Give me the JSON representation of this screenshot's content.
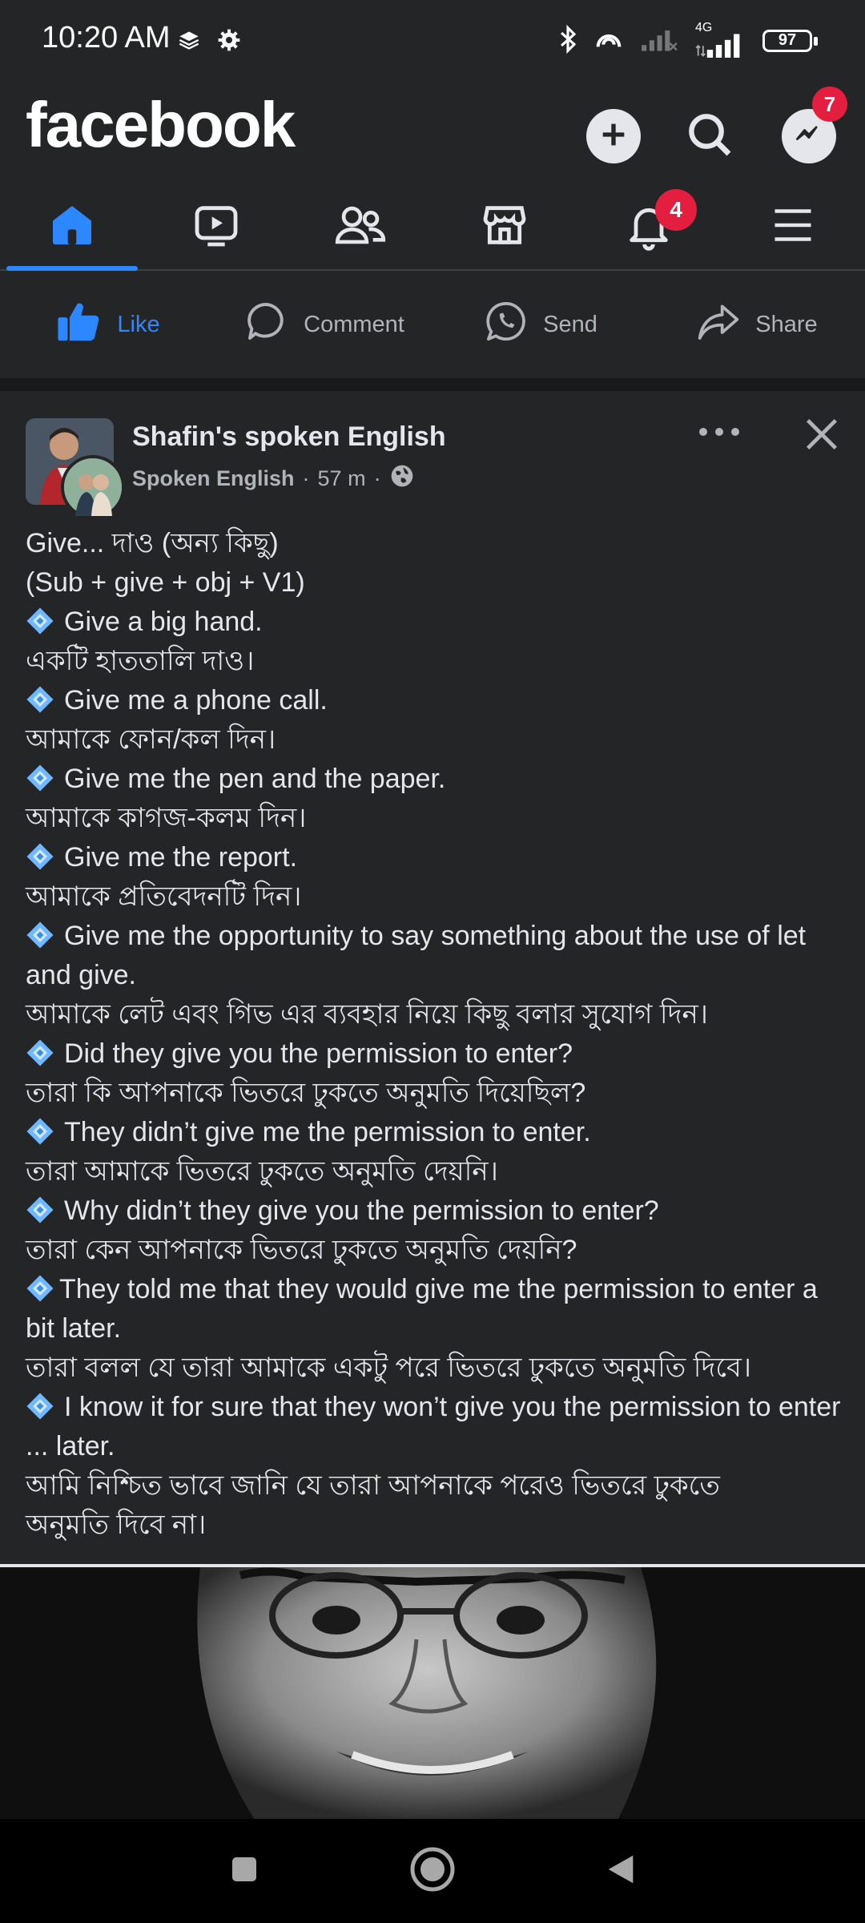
{
  "status": {
    "time": "10:20 AM",
    "network": "4G",
    "battery": "97"
  },
  "header": {
    "logo": "facebook",
    "messenger_badge": "7"
  },
  "nav": {
    "notifications_badge": "4"
  },
  "actions": {
    "like": "Like",
    "comment": "Comment",
    "send": "Send",
    "share": "Share"
  },
  "post": {
    "author": "Shafin's spoken English",
    "group": "Spoken English",
    "separator": "·",
    "time": "57 m",
    "lines": [
      "Give... দাও (অন্য কিছু)",
      "(Sub + give + obj + V1)",
      "Give a big hand.",
      "একটি হাততালি দাও।",
      "Give me a phone call.",
      "আমাকে ফোন/কল দিন।",
      "Give me the pen and the paper.",
      "আমাকে কাগজ-কলম দিন।",
      "Give me the report.",
      "আমাকে প্রতিবেদনটি দিন।",
      "Give me the opportunity to say something about the use of let and give.",
      "আমাকে লেট এবং গিভ এর ব্যবহার নিয়ে কিছু বলার সুযোগ দিন।",
      "Did they give you the permission to enter?",
      "তারা কি আপনাকে ভিতরে ঢুকতে অনুমতি দিয়েছিল?",
      "They didn’t give me the permission to enter.",
      "তারা আমাকে ভিতরে ঢুকতে অনুমতি দেয়নি।",
      "Why didn’t they give you the permission to enter?",
      "তারা কেন আপনাকে ভিতরে ঢুকতে অনুমতি দেয়নি?",
      "They told me that they would give me the permission to enter a bit later.",
      "তারা বলল যে তারা আমাকে একটু পরে ভিতরে ঢুকতে অনুমতি দিবে।",
      "I know it for sure that they won’t give you the permission to enter ... later.",
      "আমি নিশ্চিত ভাবে জানি যে তারা আপনাকে পরেও ভিতরে ঢুকতে অনুমতি দিবে না।"
    ]
  },
  "colors": {
    "background": "#242526",
    "accent": "#2d88ff",
    "badge": "#e41e3f",
    "diamond": "#6fb8ff"
  },
  "icons": {
    "status_left": [
      "layers-icon",
      "gear-icon"
    ],
    "status_right": [
      "bluetooth-icon",
      "hotspot-icon",
      "signal-icon",
      "signal-4g-icon",
      "battery-icon"
    ],
    "header": [
      "add-icon",
      "search-icon",
      "messenger-icon"
    ],
    "nav": [
      "home-icon",
      "video-icon",
      "friends-icon",
      "marketplace-icon",
      "bell-icon",
      "menu-icon"
    ],
    "post": [
      "more-icon",
      "close-icon",
      "globe-icon",
      "diamond-bullet-icon"
    ],
    "system": [
      "recents-icon",
      "home-circle-icon",
      "back-icon"
    ]
  }
}
